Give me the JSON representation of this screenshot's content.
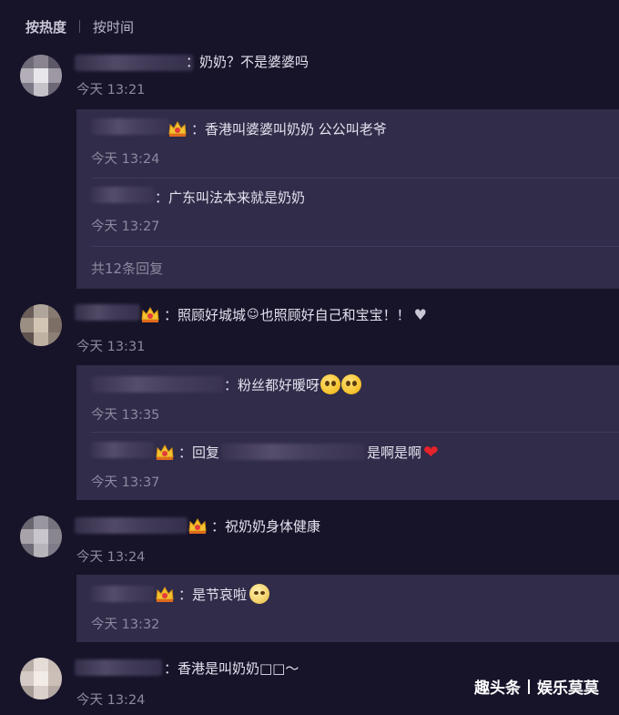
{
  "sort": {
    "hot": "按热度",
    "time": "按时间"
  },
  "comments": [
    {
      "text": "：奶奶？不是婆婆吗",
      "time": "今天 13:21",
      "replies": [
        {
          "text": "：香港叫婆婆叫奶奶 公公叫老爷",
          "time": "今天 13:24"
        },
        {
          "text": "：广东叫法本来就是奶奶",
          "time": "今天 13:27"
        }
      ],
      "more_label": "共12条回复"
    },
    {
      "text": "：照顾好城城",
      "text2": "也照顾好自己和宝宝！！",
      "time": "今天 13:31",
      "replies": [
        {
          "text": "：粉丝都好暖呀",
          "time": "今天 13:35"
        },
        {
          "text_a": "：回复",
          "text_b": "是啊是啊",
          "time": "今天 13:37"
        }
      ]
    },
    {
      "text": "：祝奶奶身体健康",
      "time": "今天 13:24",
      "replies": [
        {
          "text": "：是节哀啦",
          "time": "今天 13:32"
        }
      ]
    },
    {
      "text": "：香港是叫奶奶□□～",
      "time": "今天 13:24"
    }
  ],
  "watermark": {
    "left": "趣头条",
    "right": "娱乐莫莫"
  },
  "colors": {
    "background": "#17142a",
    "reply_bg": "#302c49",
    "muted": "#8d89a0"
  },
  "icons": [
    "crown-badge-icon",
    "pleading-face-emoji",
    "flushed-face-emoji",
    "red-heart-emoji",
    "white-heart-emoji",
    "smile-emoji"
  ]
}
